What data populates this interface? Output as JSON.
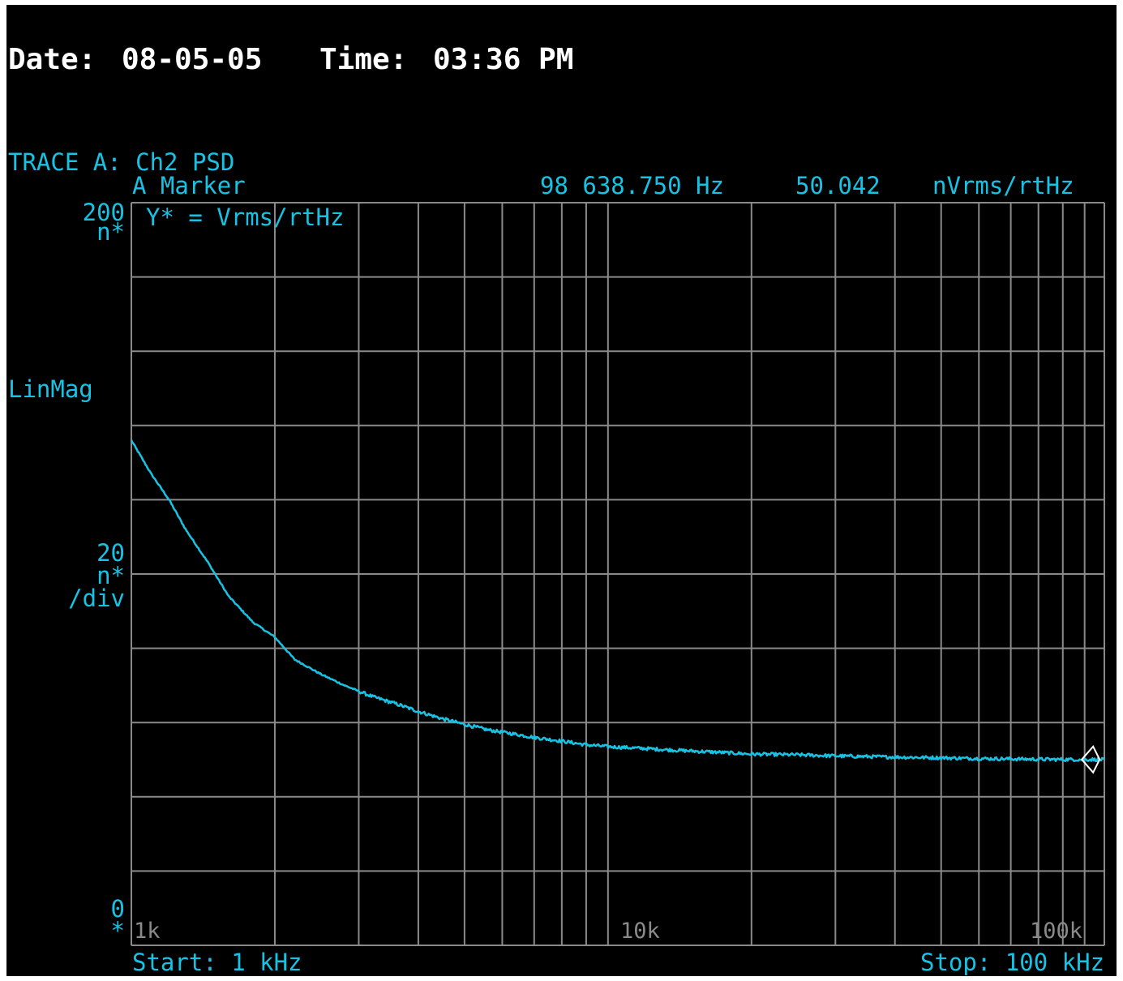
{
  "header": {
    "date_label": "Date:",
    "date_value": "08-05-05",
    "time_label": "Time:",
    "time_value": "03:36 PM"
  },
  "trace": {
    "title": "TRACE A: Ch2 PSD",
    "marker_label": "A Marker",
    "marker_freq": "98 638.750 Hz",
    "marker_value": "50.042",
    "marker_unit": "nVrms/rtHz",
    "y_unit_note": "Y* = Vrms/rtHz"
  },
  "yaxis": {
    "top_value": "200",
    "top_unit": "n*",
    "scale_type": "LinMag",
    "scale_value": "20",
    "scale_unit": "n*",
    "scale_per": "/div",
    "bottom_value": "0",
    "bottom_unit": "*"
  },
  "xaxis": {
    "tick_1k": "1k",
    "tick_10k": "10k",
    "tick_100k": "100k",
    "start": "Start: 1 kHz",
    "stop": "Stop: 100 kHz"
  },
  "colors": {
    "background": "#000000",
    "trace": "#17c3e4",
    "grid": "#8a8a8a",
    "header_text": "#ffffff"
  },
  "chart_data": {
    "type": "line",
    "x_scale": "log",
    "xlim": [
      1000,
      110000
    ],
    "ylim": [
      0,
      200
    ],
    "grid": true,
    "x_unit": "Hz",
    "y_unit": "nVrms/rtHz",
    "series": [
      {
        "x": [
          1000,
          1100,
          1200,
          1300,
          1450,
          1600,
          1800,
          2000,
          2200,
          2500,
          2800,
          3200,
          3600,
          4000,
          4500,
          5000,
          5600,
          6300,
          7000,
          8000,
          9000,
          10000,
          12000,
          14000,
          17000,
          20000,
          25000,
          30000,
          40000,
          50000,
          60000,
          70000,
          80000,
          90000,
          98638.75,
          110000
        ],
        "y": [
          136,
          127,
          120,
          112,
          103,
          94,
          87,
          83,
          77,
          73,
          70,
          67,
          65,
          63,
          61,
          59.5,
          58,
          57,
          56,
          55,
          54,
          53.5,
          53,
          52.5,
          52,
          51.5,
          51.3,
          51,
          50.7,
          50.5,
          50.3,
          50.2,
          50.1,
          50.05,
          50.042,
          50
        ]
      }
    ],
    "marker": {
      "x": 98638.75,
      "y": 50.042
    }
  }
}
